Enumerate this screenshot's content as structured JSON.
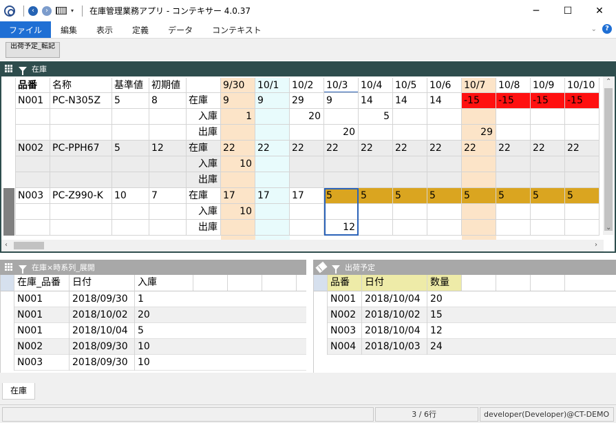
{
  "window": {
    "title": "在庫管理業務アプリ - コンテキサー 4.0.37",
    "minimize": "─",
    "maximize": "☐",
    "close": "✕"
  },
  "quick_access": {
    "back": "‹",
    "forward": "›",
    "dropdown": "▾"
  },
  "menu": {
    "items": [
      "ファイル",
      "編集",
      "表示",
      "定義",
      "データ",
      "コンテキスト"
    ],
    "collapse": "⌄",
    "help": "?"
  },
  "toolbar": {
    "button_label": "出荷予定_転記"
  },
  "main_panel": {
    "title": "在庫",
    "fixed_headers": [
      "品番",
      "名称",
      "基準値",
      "初期値",
      ""
    ],
    "dates": [
      "9/30",
      "10/1",
      "10/2",
      "10/3",
      "10/4",
      "10/5",
      "10/6",
      "10/7",
      "10/8",
      "10/9",
      "10/10"
    ],
    "items": [
      {
        "code": "N001",
        "name": "PC-N305Z",
        "standard": "5",
        "initial": "8",
        "rows": [
          {
            "label": "在庫",
            "values": [
              "9",
              "9",
              "29",
              "9",
              "14",
              "14",
              "14",
              "-15",
              "-15",
              "-15",
              "-15"
            ]
          },
          {
            "label": "入庫",
            "values": [
              "1",
              "",
              "20",
              "",
              "5",
              "",
              "",
              "",
              "",
              "",
              ""
            ]
          },
          {
            "label": "出庫",
            "values": [
              "",
              "",
              "",
              "20",
              "",
              "",
              "",
              "29",
              "",
              "",
              ""
            ]
          }
        ]
      },
      {
        "code": "N002",
        "name": "PC-PPH67",
        "standard": "5",
        "initial": "12",
        "rows": [
          {
            "label": "在庫",
            "values": [
              "22",
              "22",
              "22",
              "22",
              "22",
              "22",
              "22",
              "22",
              "22",
              "22",
              "22"
            ]
          },
          {
            "label": "入庫",
            "values": [
              "10",
              "",
              "",
              "",
              "",
              "",
              "",
              "",
              "",
              "",
              ""
            ]
          },
          {
            "label": "出庫",
            "values": [
              "",
              "",
              "",
              "",
              "",
              "",
              "",
              "",
              "",
              "",
              ""
            ]
          }
        ]
      },
      {
        "code": "N003",
        "name": "PC-Z990-K",
        "standard": "10",
        "initial": "7",
        "rows": [
          {
            "label": "在庫",
            "values": [
              "17",
              "17",
              "17",
              "5",
              "5",
              "5",
              "5",
              "5",
              "5",
              "5",
              "5"
            ]
          },
          {
            "label": "入庫",
            "values": [
              "10",
              "",
              "",
              "",
              "",
              "",
              "",
              "",
              "",
              "",
              ""
            ]
          },
          {
            "label": "出庫",
            "values": [
              "",
              "",
              "",
              "12",
              "",
              "",
              "",
              "",
              "",
              "",
              ""
            ]
          }
        ]
      }
    ],
    "colors": {
      "weekend": "#fce4c8",
      "today": "#e8fbfc",
      "negative": "#ff1010",
      "low_stock": "#daa520",
      "grid": "#d4d4d4"
    }
  },
  "receipts_panel": {
    "title": "在庫×時系列_展開",
    "headers": [
      "在庫_品番",
      "日付",
      "入庫"
    ],
    "rows": [
      [
        "N001",
        "2018/09/30",
        "1"
      ],
      [
        "N001",
        "2018/10/02",
        "20"
      ],
      [
        "N001",
        "2018/10/04",
        "5"
      ],
      [
        "N002",
        "2018/09/30",
        "10"
      ],
      [
        "N003",
        "2018/09/30",
        "10"
      ]
    ]
  },
  "shipments_panel": {
    "title": "出荷予定",
    "headers": [
      "品番",
      "日付",
      "数量"
    ],
    "rows": [
      [
        "N001",
        "2018/10/04",
        "20"
      ],
      [
        "N002",
        "2018/10/02",
        "15"
      ],
      [
        "N003",
        "2018/10/04",
        "12"
      ],
      [
        "N004",
        "2018/10/03",
        "24"
      ]
    ]
  },
  "tabs": [
    "在庫"
  ],
  "status": {
    "message": "",
    "record_count": "3 / 6行",
    "user": "developer(Developer)@CT-DEMO"
  }
}
